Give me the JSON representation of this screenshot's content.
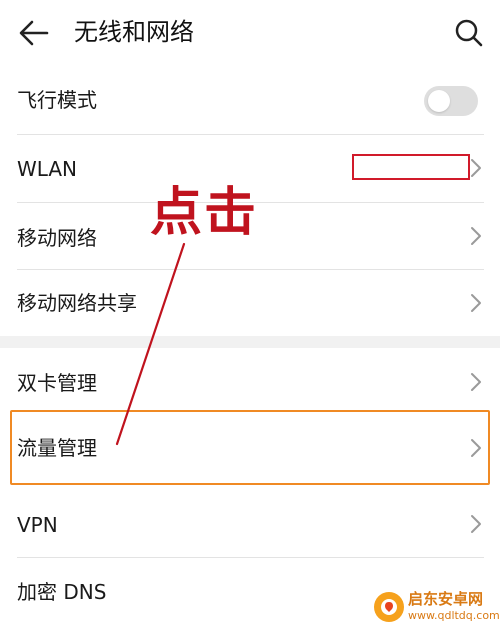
{
  "header": {
    "title": "无线和网络",
    "back_icon": "arrow-left-icon",
    "search_icon": "search-icon"
  },
  "rows": [
    {
      "label": "飞行模式",
      "control": "toggle",
      "toggle_on": false
    },
    {
      "label": "WLAN",
      "control": "chevron"
    },
    {
      "label": "移动网络",
      "control": "chevron"
    },
    {
      "label": "移动网络共享",
      "control": "chevron"
    },
    {
      "label": "双卡管理",
      "control": "chevron"
    },
    {
      "label": "流量管理",
      "control": "chevron"
    },
    {
      "label": "VPN",
      "control": "chevron"
    },
    {
      "label": "加密 DNS",
      "control": "chevron"
    }
  ],
  "annotation": {
    "text": "点击",
    "color": "#c0131e",
    "highlight_color": "#f08a24",
    "redaction_color": "#d11a2a"
  },
  "watermark": {
    "title": "启东安卓网",
    "url": "www.qdltdq.com"
  }
}
